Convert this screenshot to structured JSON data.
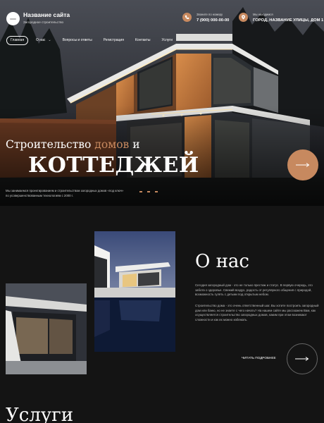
{
  "header": {
    "site_title": "Название сайта",
    "site_subtitle": "Загородное строительство",
    "phone_label": "Звоните по номеру",
    "phone": "7 (900) 000-00-00",
    "address_label": "Мы находимся",
    "address": "ГОРОД, НАЗВАНИЕ УЛИЦЫ, ДОМ 1"
  },
  "nav": {
    "items": [
      {
        "label": "Главная",
        "active": true
      },
      {
        "label": "О нас",
        "has_dropdown": true
      },
      {
        "label": "Вопросы и ответы"
      },
      {
        "label": "Регистрация"
      },
      {
        "label": "Контакты"
      },
      {
        "label": "Услуги"
      }
    ]
  },
  "hero": {
    "title_part1": "Строительство ",
    "title_accent": "домов",
    "title_part2": " и",
    "title_big": "КОТТЕДЖЕЙ",
    "text": "Мы занимаемся проектированием и строительством загородных домов «под ключ» по усовершенствованным технологиям с 2000 г.",
    "arrow_icon": "arrow-right-icon"
  },
  "about": {
    "title": "О нас",
    "paragraph1": "Сегодня загородный дом - это не только престиж и статус. В первую очередь, это забота о здоровье. Свежий воздух, радость от регулярного общения с природой, возможность гулять с детьми под открытым небом.",
    "paragraph2": "Строительство дома - это очень ответственный шаг. Вы хотите построить загородный дом или баню, но не знаете с чего начать? На нашем сайте мы расскажем Вам, как осуществляется строительство загородных домов, каким при этом возникают сложности и как их можно избежать.",
    "more_label": "ЧИТАТЬ ПОДРОБНЕЕ"
  },
  "services": {
    "title": "Услуги"
  },
  "colors": {
    "accent": "#c7895f",
    "background": "#141414"
  }
}
